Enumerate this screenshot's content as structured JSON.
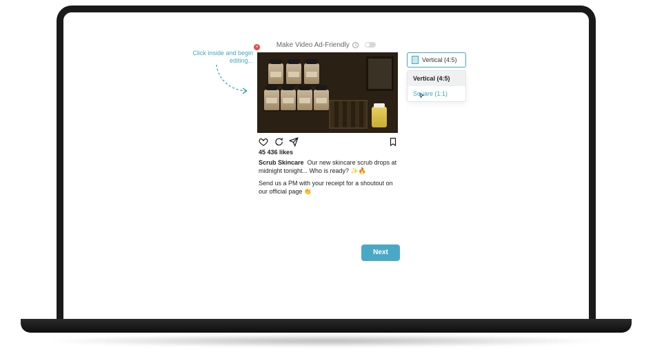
{
  "header": {
    "label": "Make Video Ad-Friendly",
    "toggle_state": "off"
  },
  "hint": {
    "text": "Click inside and begin editing..."
  },
  "post": {
    "likes": "45 436 likes",
    "username": "Scrub Skincare",
    "caption_line1": "Our new skincare scrub drops at midnight tonight... Who is ready? ✨🔥",
    "caption_line2": "Send us a PM with your receipt for a shoutout on our official page 👏"
  },
  "dropdown": {
    "selected": "Vertical (4:5)",
    "options": [
      {
        "label": "Vertical (4:5)",
        "active": true
      },
      {
        "label": "Square (1:1)",
        "active": false,
        "hover": true
      }
    ]
  },
  "actions": {
    "next": "Next"
  },
  "icons": {
    "like": "heart-icon",
    "comment": "comment-icon",
    "share": "send-icon",
    "save": "bookmark-icon",
    "info": "info-icon",
    "close": "close-icon",
    "cursor": "cursor-icon"
  }
}
